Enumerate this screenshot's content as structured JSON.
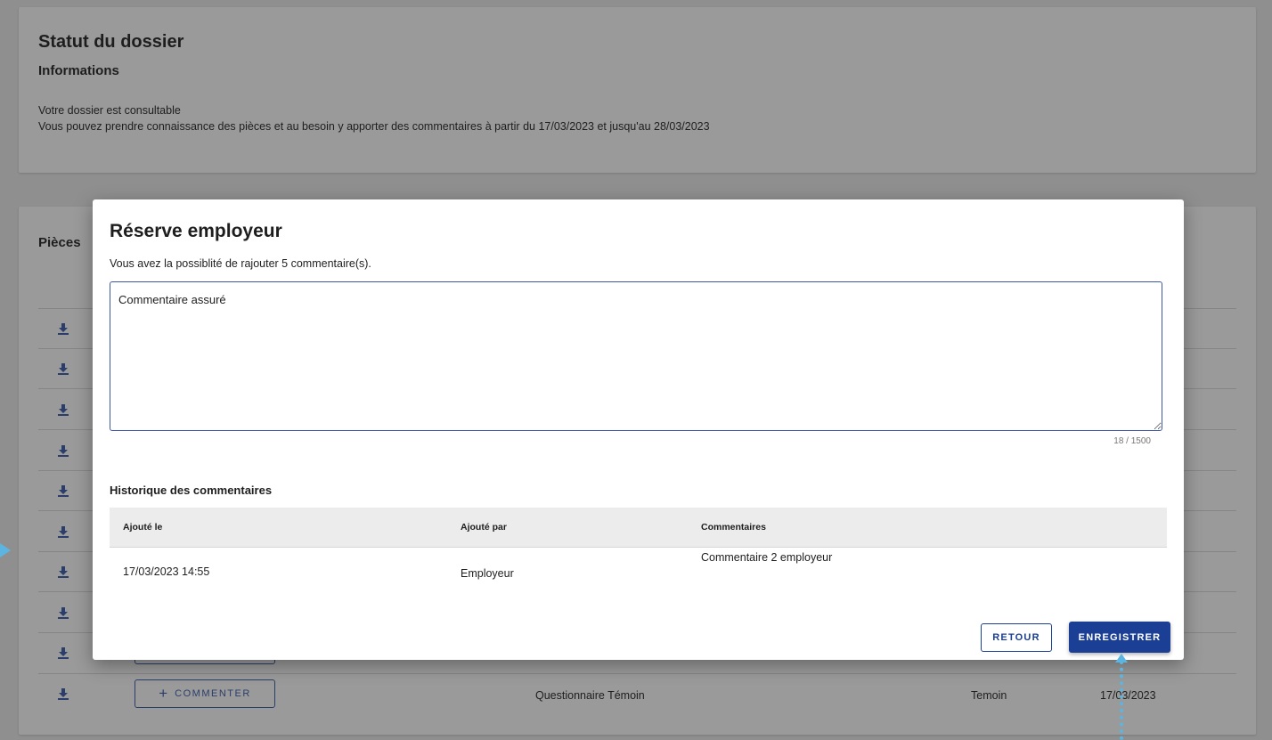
{
  "status": {
    "title": "Statut du dossier",
    "subtitle": "Informations",
    "line1": "Votre dossier est consultable",
    "line2": "Vous pouvez prendre connaissance des pièces et au besoin y apporter des commentaires à partir du 17/03/2023 et jusqu'au 28/03/2023"
  },
  "pieces": {
    "title": "Pièces",
    "row_count": 10,
    "last_row": {
      "button": "COMMENTER",
      "document": "Questionnaire Témoin",
      "added_by": "Temoin",
      "date": "17/03/2023"
    }
  },
  "modal": {
    "title": "Réserve employeur",
    "subtitle": "Vous avez la possiblité de rajouter 5 commentaire(s).",
    "textarea_value": "Commentaire assuré",
    "counter": "18 / 1500",
    "history_title": "Historique des commentaires",
    "history_columns": [
      "Ajouté le",
      "Ajouté par",
      "Commentaires"
    ],
    "history_rows": [
      {
        "date": "17/03/2023 14:55",
        "by": "Employeur",
        "comment": "Commentaire 2 employeur"
      }
    ],
    "retour_label": "RETOUR",
    "save_label": "ENREGISTRER"
  },
  "colors": {
    "primary": "#1b3f94",
    "overlay": "#8f8f8f",
    "guide": "#5bb5e0"
  }
}
